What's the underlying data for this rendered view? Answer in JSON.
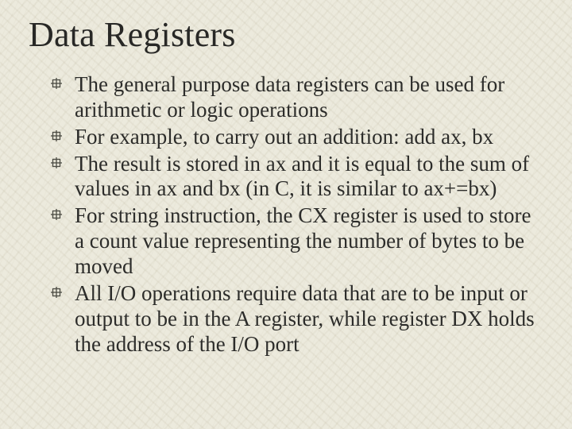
{
  "title": "Data Registers",
  "bullets": [
    "The general purpose data registers can be used for arithmetic or logic operations",
    "For example, to carry out an addition: add ax, bx",
    "The result is stored in ax and it is equal to the sum of values in ax and bx (in C, it is similar to ax+=bx)",
    "For string instruction, the CX register is used to store a count value representing the number of bytes to be moved",
    "All I/O operations require data that are to be input or output to be in the A register, while register DX holds the address of the I/O port"
  ]
}
